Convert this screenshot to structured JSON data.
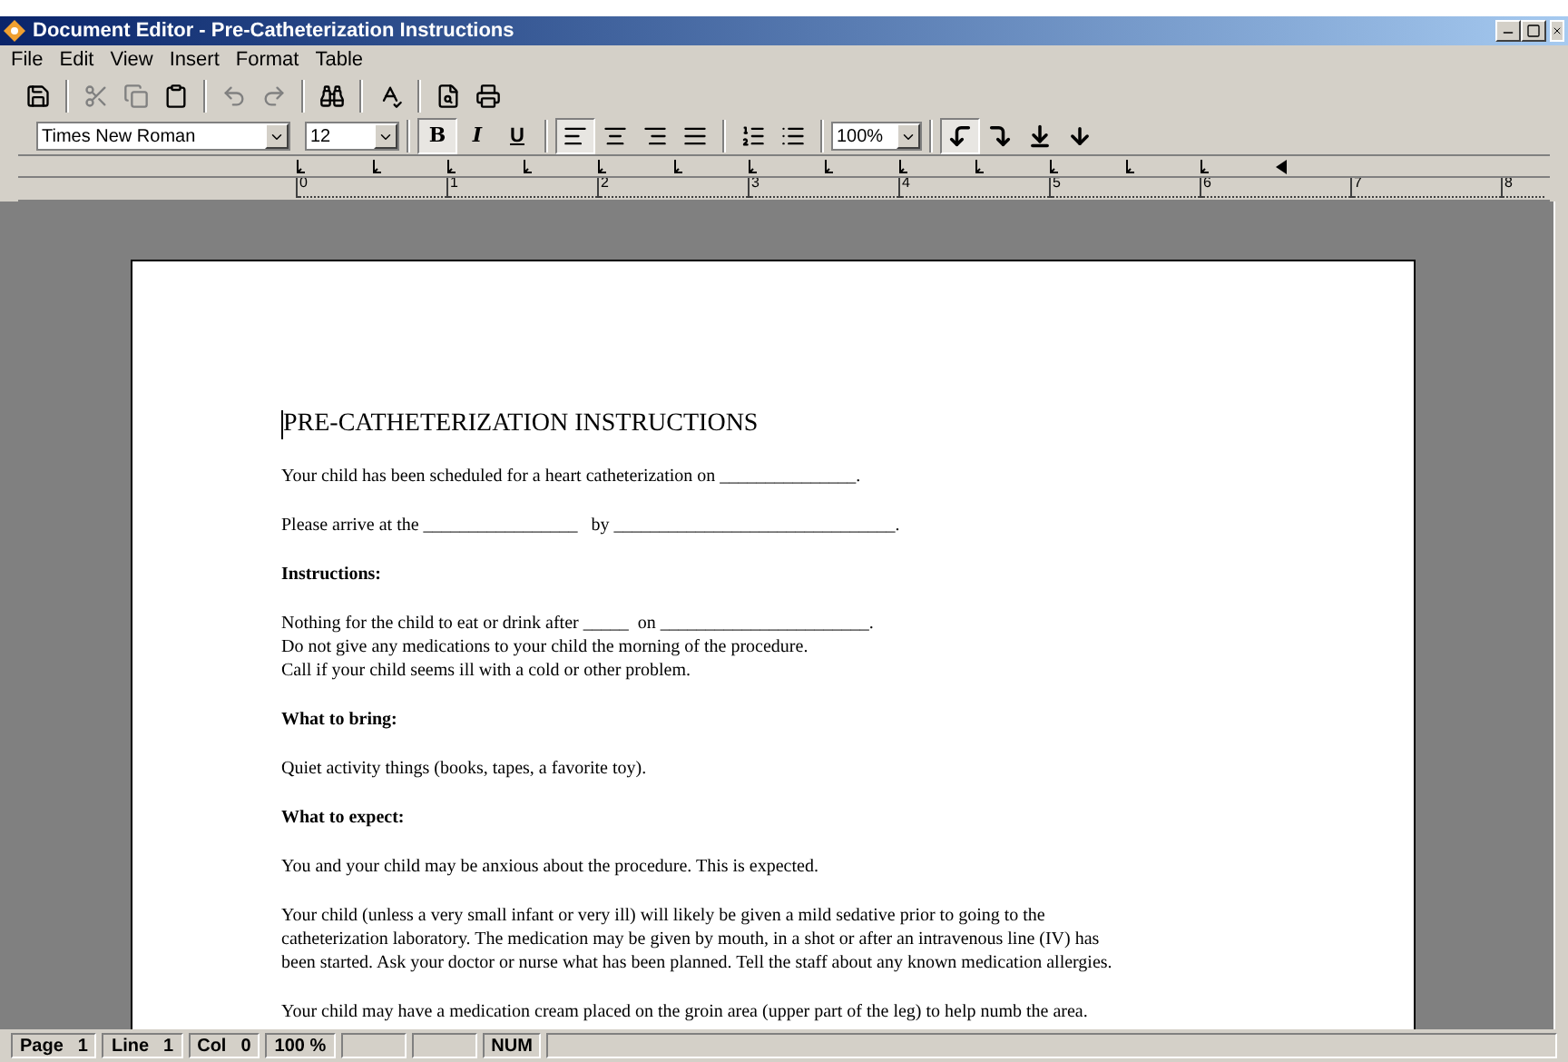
{
  "window": {
    "title": "Document Editor - Pre-Catheterization Instructions"
  },
  "menu": [
    "File",
    "Edit",
    "View",
    "Insert",
    "Format",
    "Table"
  ],
  "format_bar": {
    "font": "Times New Roman",
    "size": "12",
    "zoom": "100%",
    "style_buttons": [
      {
        "kind": "bold",
        "label": "B",
        "pressed": true
      },
      {
        "kind": "italic",
        "label": "I",
        "pressed": false
      },
      {
        "kind": "underline",
        "label": "U",
        "pressed": false
      }
    ],
    "align_buttons": [
      {
        "selected": true
      },
      {
        "selected": false
      },
      {
        "selected": false
      },
      {
        "selected": false
      }
    ],
    "tab_buttons": [
      {
        "selected": true
      },
      {
        "selected": false
      },
      {
        "selected": false
      },
      {
        "selected": false
      }
    ]
  },
  "ruler": {
    "labels": [
      "0",
      "1",
      "2",
      "3",
      "4",
      "5",
      "6",
      "7",
      "8"
    ]
  },
  "document": [
    {
      "kind": "title",
      "lines": [
        "PRE-CATHETERIZATION INSTRUCTIONS"
      ]
    },
    {
      "kind": "para",
      "lines": [
        "Your child has been scheduled for a heart catheterization on _______________."
      ]
    },
    {
      "kind": "para",
      "lines": [
        "Please arrive at the _________________   by _______________________________."
      ]
    },
    {
      "kind": "heading",
      "lines": [
        "Instructions:"
      ]
    },
    {
      "kind": "para",
      "lines": [
        "Nothing for the child to eat or drink after _____  on _______________________.",
        "Do not give any medications to your child the morning of the procedure.",
        "Call if your child seems ill with a cold or other problem."
      ]
    },
    {
      "kind": "heading",
      "lines": [
        "What to bring:"
      ]
    },
    {
      "kind": "para",
      "lines": [
        "Quiet activity things (books, tapes, a favorite toy)."
      ]
    },
    {
      "kind": "heading",
      "lines": [
        "What to expect:"
      ]
    },
    {
      "kind": "para",
      "lines": [
        "You and your child may be anxious about the procedure. This is expected."
      ]
    },
    {
      "kind": "para",
      "lines": [
        "Your child (unless a very small infant or very ill) will likely be given a mild sedative prior to going to the",
        "catheterization laboratory. The medication may be given by mouth, in a shot or after an intravenous line (IV) has",
        "been started. Ask your doctor or nurse what has been planned. Tell the staff about any known medication allergies."
      ]
    },
    {
      "kind": "para",
      "lines": [
        "Your child may have a medication cream placed on the groin area (upper part of the leg) to help numb the area."
      ]
    }
  ],
  "status_bar": [
    {
      "label": "Page",
      "value": "1"
    },
    {
      "label": "Line",
      "value": "1"
    },
    {
      "label": "Col",
      "value": "0"
    },
    {
      "label": "100 %"
    },
    {
      "label": "NUM"
    }
  ]
}
